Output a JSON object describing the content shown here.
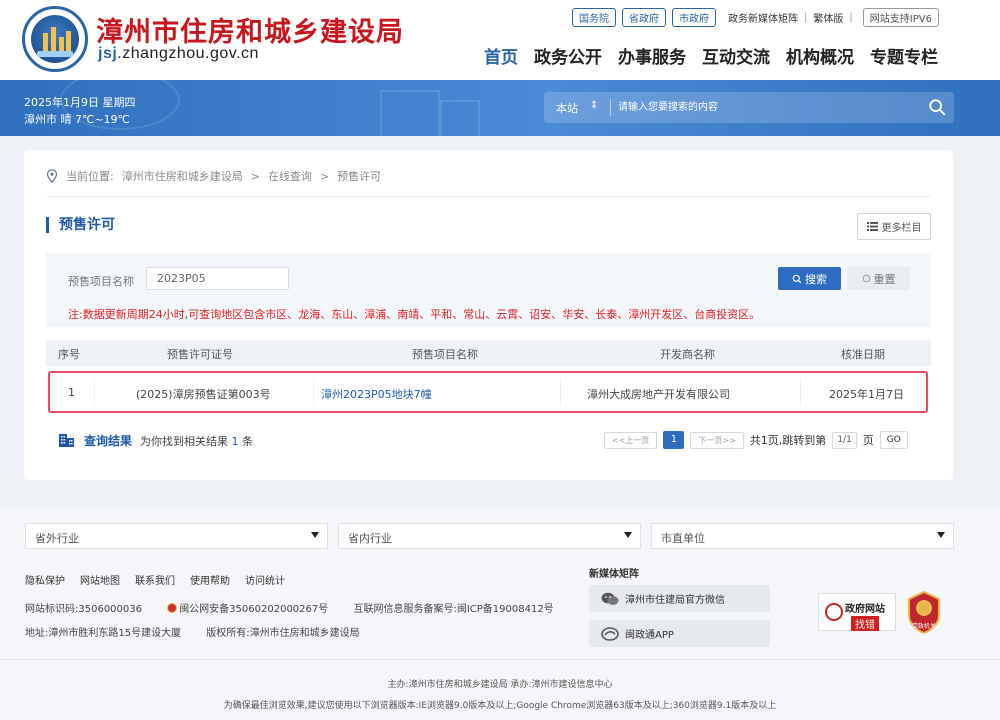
{
  "header": {
    "site_title": "漳州市住房和城乡建设局",
    "domain_prefix": "jsj",
    "domain_rest": ".zhangzhou.gov.cn",
    "top_links": {
      "state_council": "国务院",
      "province_gov": "省政府",
      "city_gov": "市政府",
      "new_media": "政务新媒体矩阵",
      "traditional": "繁体版",
      "ipv6": "网站支持IPV6"
    },
    "nav": [
      "首页",
      "政务公开",
      "办事服务",
      "互动交流",
      "机构概况",
      "专题专栏"
    ]
  },
  "banner": {
    "date": "2025年1月9日 星期四",
    "weather": "漳州市  晴 7℃~19℃",
    "search_scope": "本站",
    "search_placeholder": "请输入您要搜索的内容"
  },
  "breadcrumb": {
    "label": "当前位置:",
    "items": [
      "漳州市住房和城乡建设局",
      "在线查询",
      "预售许可"
    ]
  },
  "section": {
    "title": "预售许可",
    "more_label": "更多栏目"
  },
  "filter": {
    "label": "预售项目名称",
    "value": "2023P05",
    "search_label": "搜索",
    "reset_label": "重置",
    "note": "注:数据更新周期24小时,可查询地区包含市区、龙海、东山、漳浦、南靖、平和、常山、云霄、诏安、华安、长泰、漳州开发区、台商投资区。"
  },
  "table": {
    "headers": [
      "序号",
      "预售许可证号",
      "预售项目名称",
      "开发商名称",
      "核准日期"
    ],
    "rows": [
      {
        "index": "1",
        "permit": "(2025)漳房预售证第003号",
        "project": "漳州2023P05地块7幢",
        "developer": "漳州大成房地产开发有限公司",
        "date": "2025年1月7日"
      }
    ]
  },
  "results": {
    "title": "查询结果",
    "prefix": "为你找到相关结果",
    "count": "1",
    "suffix": "条"
  },
  "pagination": {
    "prev": "<<上一页",
    "current": "1",
    "next": "下一页>>",
    "total_text": "共1页,跳转到第",
    "page_box": "1/1",
    "page_suffix": "页",
    "go": "GO"
  },
  "footer": {
    "selects": [
      "省外行业",
      "省内行业",
      "市直单位"
    ],
    "links": [
      "隐私保护",
      "网站地图",
      "联系我们",
      "使用帮助",
      "访问统计"
    ],
    "site_id": "网站标识码:3506000036",
    "police": "闽公网安备35060202000267号",
    "icp": "互联网信息服务备案号:闽ICP备19008412号",
    "address": "地址:漳州市胜利东路15号建设大厦",
    "copyright": "版权所有:漳州市住房和城乡建设局",
    "media_title": "新媒体矩阵",
    "wechat": "漳州市住建局官方微信",
    "app": "闽政通APP",
    "gov_badge_1": "政府网站",
    "gov_badge_2": "找错",
    "party_badge": "党政机关",
    "sponsor": "主办:漳州市住房和城乡建设局 承办:漳州市建设信息中心",
    "browser_note": "为确保最佳浏览效果,建议您使用以下浏览器版本:IE浏览器9.0版本及以上;Google Chrome浏览器63版本及以上;360浏览器9.1版本及以上"
  },
  "colors": {
    "brand_red": "#c8161d",
    "brand_blue": "#2a64a8",
    "highlight": "#e8475f"
  }
}
